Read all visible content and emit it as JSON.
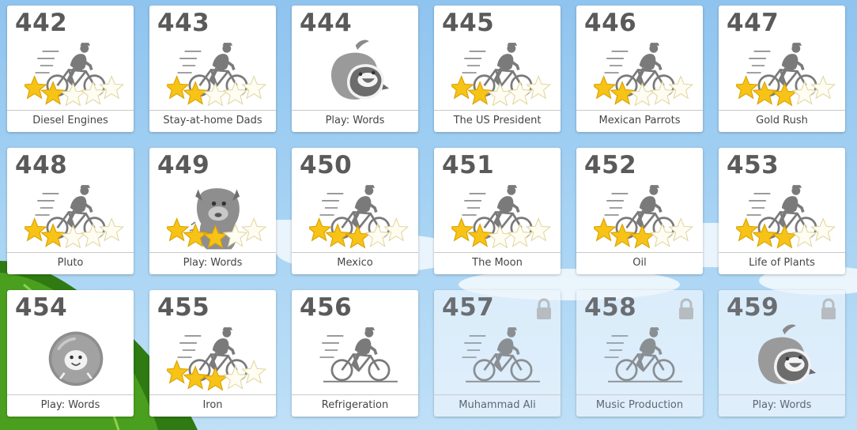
{
  "tiles": [
    {
      "number": "442",
      "label": "Diesel Engines",
      "type": "lesson",
      "stars_filled": 2,
      "locked": false
    },
    {
      "number": "443",
      "label": "Stay-at-home Dads",
      "type": "lesson",
      "stars_filled": 2,
      "locked": false
    },
    {
      "number": "444",
      "label": "Play: Words",
      "type": "play-apple",
      "locked": false
    },
    {
      "number": "445",
      "label": "The US President",
      "type": "lesson",
      "stars_filled": 2,
      "locked": false
    },
    {
      "number": "446",
      "label": "Mexican Parrots",
      "type": "lesson",
      "stars_filled": 2,
      "locked": false
    },
    {
      "number": "447",
      "label": "Gold Rush",
      "type": "lesson",
      "stars_filled": 3,
      "locked": false
    },
    {
      "number": "448",
      "label": "Pluto",
      "type": "lesson",
      "stars_filled": 2,
      "locked": false
    },
    {
      "number": "449",
      "label": "Play: Words",
      "type": "play-creature",
      "stars_filled": 3,
      "locked": false
    },
    {
      "number": "450",
      "label": "Mexico",
      "type": "lesson",
      "stars_filled": 3,
      "locked": false
    },
    {
      "number": "451",
      "label": "The Moon",
      "type": "lesson",
      "stars_filled": 2,
      "locked": false
    },
    {
      "number": "452",
      "label": "Oil",
      "type": "lesson",
      "stars_filled": 3,
      "locked": false
    },
    {
      "number": "453",
      "label": "Life of Plants",
      "type": "lesson",
      "stars_filled": 3,
      "locked": false
    },
    {
      "number": "454",
      "label": "Play: Words",
      "type": "play-bubble",
      "locked": false
    },
    {
      "number": "455",
      "label": "Iron",
      "type": "lesson",
      "stars_filled": 3,
      "locked": false
    },
    {
      "number": "456",
      "label": "Refrigeration",
      "type": "lesson-nostars",
      "locked": false
    },
    {
      "number": "457",
      "label": "Muhammad Ali",
      "type": "lesson-nostars",
      "locked": true
    },
    {
      "number": "458",
      "label": "Music Production",
      "type": "lesson-nostars",
      "locked": true
    },
    {
      "number": "459",
      "label": "Play: Words",
      "type": "play-apple",
      "locked": true
    }
  ],
  "colors": {
    "star_fill": "#f7c316",
    "star_empty": "#fffdf2",
    "icon_gray": "#7a7a7a",
    "sky": "#a9d4f4",
    "leaf": "#3f8a1c"
  },
  "icons": {
    "lesson": "cyclist-icon",
    "play-apple": "apple-bird-icon",
    "play-creature": "creature-icon",
    "play-bubble": "bubble-bird-icon",
    "locked": "lock-icon",
    "star": "star-icon"
  }
}
